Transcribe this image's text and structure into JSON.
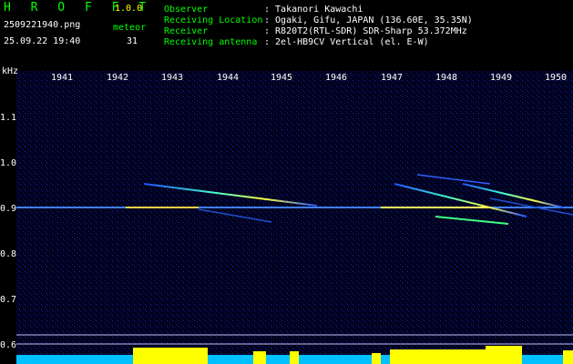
{
  "app": {
    "name": "H R O F F T",
    "version": "1.0.0"
  },
  "file": {
    "name": "2509221940.png",
    "datetime": "25.09.22 19:40"
  },
  "meteor": {
    "label": "meteor",
    "count": "31"
  },
  "info": [
    {
      "key": "Observer",
      "value": ": Takanori Kawachi"
    },
    {
      "key": "Receiving Location",
      "value": ": Ogaki, Gifu, JAPAN (136.60E, 35.35N)"
    },
    {
      "key": "Receiver",
      "value": ": R820T2(RTL-SDR) SDR-Sharp 53.372MHz"
    },
    {
      "key": "Receiving antenna",
      "value": ": 2el-HB9CV Vertical (el. E-W)"
    }
  ],
  "axis": {
    "yunit": "kHz",
    "x_ticks": [
      "1941",
      "1942",
      "1943",
      "1944",
      "1945",
      "1946",
      "1947",
      "1948",
      "1949",
      "1950"
    ],
    "y_ticks": [
      "1.1",
      "1.0",
      "0.9",
      "0.8",
      "0.7",
      "0.6"
    ]
  },
  "colors": {
    "label": "#00ff00",
    "text": "#ffffff",
    "accent": "#ffff00",
    "bg": "#000010"
  }
}
